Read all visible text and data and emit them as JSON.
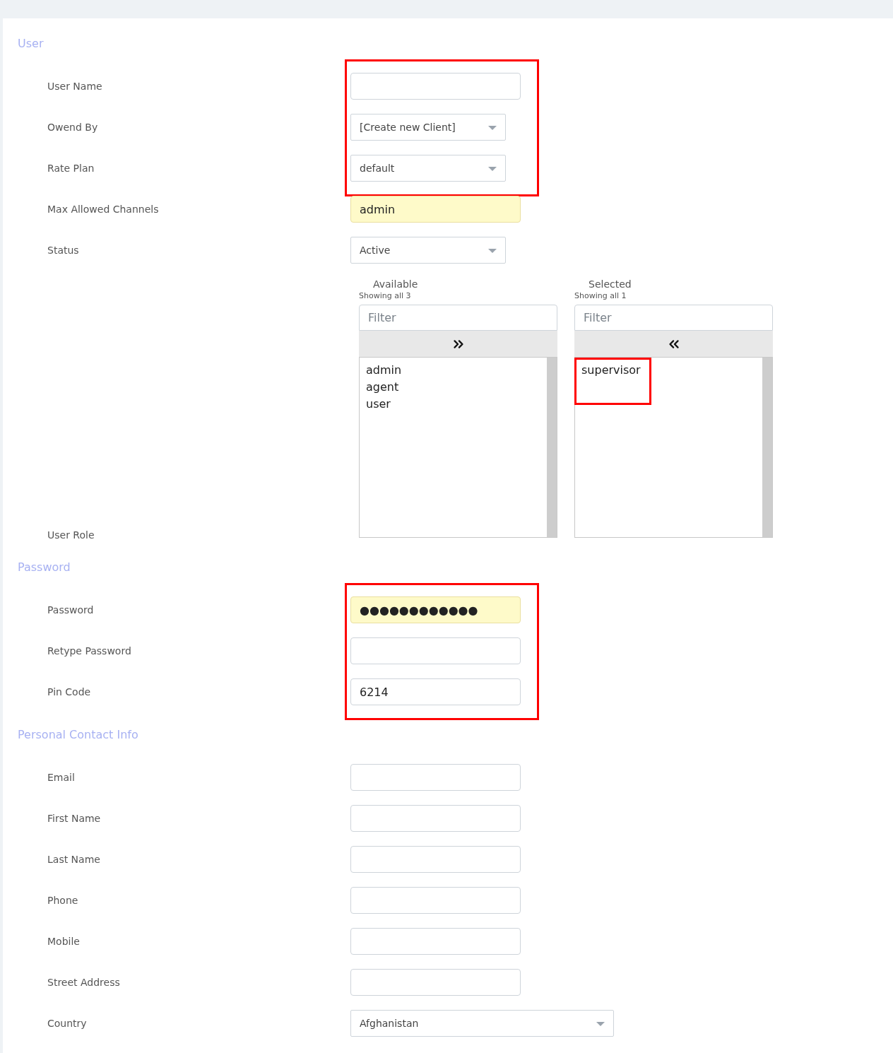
{
  "sections": [
    {
      "title": "User",
      "fields": [
        {
          "kind": "text",
          "label": "User Name",
          "highlighted": true,
          "autofilled": false
        },
        {
          "kind": "select",
          "label": "Owend By",
          "value": "[Create new Client]",
          "highlighted": true
        },
        {
          "kind": "select",
          "label": "Rate Plan",
          "value": "default",
          "highlighted": true
        },
        {
          "kind": "text",
          "label": "Max Allowed Channels",
          "value": "admin",
          "highlighted": false,
          "autofilled": true
        },
        {
          "kind": "select",
          "label": "Status",
          "value": "Active",
          "highlighted": false
        },
        {
          "kind": "duallist",
          "label": "User Role",
          "highlighted": false,
          "panes": [
            {
              "title": "Available",
              "count": "Showing all 3",
              "placeholder": "Filter",
              "kind": "add",
              "items": [
                {
                  "label": "admin",
                  "highlighted": false
                },
                {
                  "label": "agent",
                  "highlighted": false
                },
                {
                  "label": "user",
                  "highlighted": false
                }
              ]
            },
            {
              "title": "Selected",
              "count": "Showing all 1",
              "placeholder": "Filter",
              "kind": "remove",
              "items": [
                {
                  "label": "supervisor",
                  "highlighted": true
                }
              ]
            }
          ]
        }
      ]
    },
    {
      "title": "Password",
      "fields": [
        {
          "kind": "text",
          "label": "Password",
          "value": "●●●●●●●●●●●●",
          "highlighted": true,
          "autofilled": true
        },
        {
          "kind": "text",
          "label": "Retype Password",
          "highlighted": true,
          "autofilled": false
        },
        {
          "kind": "text",
          "label": "Pin Code",
          "value": "6214",
          "highlighted": true,
          "autofilled": false
        }
      ]
    },
    {
      "title": "Personal Contact Info",
      "fields": [
        {
          "kind": "text",
          "label": "Email",
          "highlighted": false,
          "autofilled": false
        },
        {
          "kind": "text",
          "label": "First Name",
          "highlighted": false,
          "autofilled": false
        },
        {
          "kind": "text",
          "label": "Last Name",
          "highlighted": false,
          "autofilled": false
        },
        {
          "kind": "text",
          "label": "Phone",
          "highlighted": false,
          "autofilled": false
        },
        {
          "kind": "text",
          "label": "Mobile",
          "highlighted": false,
          "autofilled": false
        },
        {
          "kind": "text",
          "label": "Street Address",
          "highlighted": false,
          "autofilled": false
        },
        {
          "kind": "wideselect",
          "label": "Country",
          "value": "Afghanistan",
          "highlighted": false
        }
      ]
    }
  ]
}
